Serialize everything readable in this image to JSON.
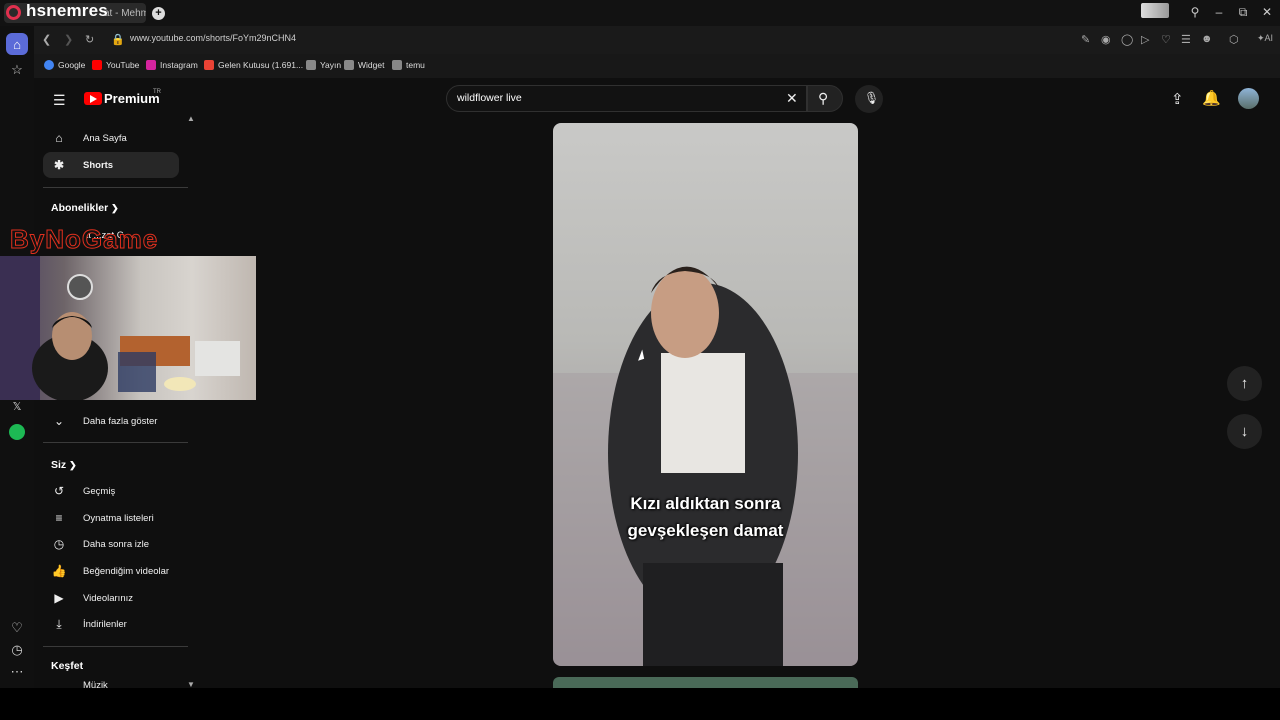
{
  "titlebar": {
    "overlay_name": "hsnemres",
    "tab_title": "at - Mehm",
    "new_tab": "+"
  },
  "addressbar": {
    "url": "www.youtube.com/shorts/FoYm29nCHN4"
  },
  "bookmarks": [
    {
      "label": "Google",
      "icon": "google-icon",
      "color": "#4285f4"
    },
    {
      "label": "YouTube",
      "icon": "youtube-icon",
      "color": "#ff0000"
    },
    {
      "label": "Instagram",
      "icon": "instagram-icon",
      "color": "#d6249f"
    },
    {
      "label": "Gelen Kutusu (1.691...",
      "icon": "gmail-icon",
      "color": "#ea4335"
    },
    {
      "label": "Yayın",
      "icon": "folder-icon",
      "color": "#888888"
    },
    {
      "label": "Widget",
      "icon": "folder-icon",
      "color": "#888888"
    },
    {
      "label": "temu",
      "icon": "folder-icon",
      "color": "#888888"
    }
  ],
  "youtube": {
    "logo_text": "Premium",
    "logo_region": "TR",
    "search_value": "wildflower live",
    "sidebar": {
      "home": "Ana Sayfa",
      "shorts": "Shorts",
      "subscriptions_header": "Abonelikler",
      "subscription_partial": "at ...zat C",
      "show_more": "Daha fazla göster",
      "you_header": "Siz",
      "history": "Geçmiş",
      "playlists": "Oynatma listeleri",
      "watch_later": "Daha sonra izle",
      "liked": "Beğendiğim videolar",
      "your_videos": "Videolarınız",
      "downloads": "İndirilenler",
      "explore_header": "Keşfet",
      "music_partial": "Müzik"
    },
    "short": {
      "caption_line1": "Kızı aldıktan sonra",
      "caption_line2": "gevşekleşen damat"
    }
  },
  "overlay": {
    "logo_text": "ByNoGame"
  },
  "colors": {
    "accent": "#ff0000",
    "opera_active": "#5b6bd8",
    "background": "#0f0f0f"
  }
}
